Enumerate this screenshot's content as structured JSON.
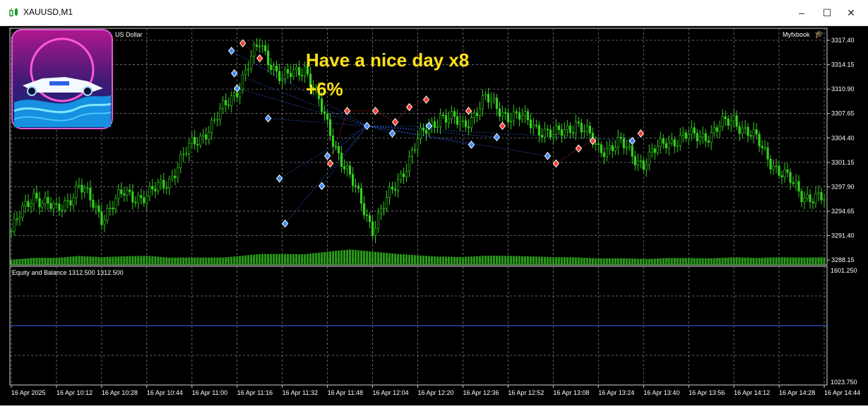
{
  "window": {
    "title": "XAUUSD,M1",
    "minimize": "–",
    "maximize": "☐",
    "close": "✕"
  },
  "main": {
    "symbol_desc": "US Dollar",
    "brand": "Myfxbook",
    "overlay_line1": "Have a nice day x8",
    "overlay_line2": "+6%",
    "price_ticks": [
      "3317.40",
      "3314.15",
      "3310.90",
      "3307.65",
      "3304.40",
      "3301.15",
      "3297.90",
      "3294.65",
      "3291.40",
      "3288.15"
    ]
  },
  "indicator": {
    "label": "Equity and Balance 1312.500 1312.500",
    "ticks": [
      "1601.250",
      "1023.750"
    ]
  },
  "time_axis": [
    "16 Apr 2025",
    "16 Apr 10:12",
    "16 Apr 10:28",
    "16 Apr 10:44",
    "16 Apr 11:00",
    "16 Apr 11:16",
    "16 Apr 11:32",
    "16 Apr 11:48",
    "16 Apr 12:04",
    "16 Apr 12:20",
    "16 Apr 12:36",
    "16 Apr 12:52",
    "16 Apr 13:08",
    "16 Apr 13:24",
    "16 Apr 13:40",
    "16 Apr 13:56",
    "16 Apr 14:12",
    "16 Apr 14:28",
    "16 Apr 14:44"
  ],
  "chart_data": {
    "type": "line",
    "series": [
      {
        "x": [
          0,
          8,
          16,
          24,
          32,
          40,
          48,
          56,
          64,
          72,
          80,
          88,
          96,
          104,
          112,
          120,
          128,
          136,
          144,
          152,
          160,
          168,
          176,
          184,
          192,
          200,
          208,
          216,
          224,
          232,
          240,
          248,
          256,
          264,
          272,
          280,
          288
        ],
        "values": [
          3292.0,
          3297.0,
          3294.5,
          3298.0,
          3294.0,
          3297.0,
          3296.5,
          3299.0,
          3303.5,
          3306.5,
          3311.0,
          3317.0,
          3312.0,
          3314.0,
          3306.0,
          3299.0,
          3292.5,
          3298.0,
          3304.0,
          3307.5,
          3306.0,
          3309.5,
          3307.5,
          3306.5,
          3304.5,
          3306.5,
          3303.0,
          3303.5,
          3301.0,
          3304.0,
          3304.5,
          3305.0,
          3307.0,
          3304.0,
          3300.0,
          3297.0,
          3296.0
        ]
      }
    ],
    "volume_levels": [
      0.45,
      0.55,
      0.5,
      0.6,
      0.5,
      0.55,
      0.6,
      0.5,
      0.55,
      0.6,
      0.7,
      0.8,
      0.75,
      0.7,
      0.85,
      1.0,
      0.9,
      0.8,
      0.75,
      0.7,
      0.6,
      0.65,
      0.6,
      0.55,
      0.5,
      0.5,
      0.45,
      0.5,
      0.5,
      0.55,
      0.5,
      0.45,
      0.5,
      0.45,
      0.5,
      0.5,
      0.55
    ],
    "equity_balance": [
      1312.5,
      1312.5
    ],
    "buy_markers": [
      [
        78,
        3316.0
      ],
      [
        79,
        3313.0
      ],
      [
        80,
        3311.0
      ],
      [
        91,
        3307.0
      ],
      [
        95,
        3299.0
      ],
      [
        97,
        3293.0
      ],
      [
        110,
        3298.0
      ],
      [
        112,
        3302.0
      ],
      [
        126,
        3306.0
      ],
      [
        135,
        3305.0
      ],
      [
        148,
        3306.0
      ],
      [
        163,
        3303.5
      ],
      [
        172,
        3304.5
      ],
      [
        190,
        3302.0
      ],
      [
        220,
        3304.0
      ]
    ],
    "sell_markers": [
      [
        82,
        3317.0
      ],
      [
        88,
        3315.0
      ],
      [
        113,
        3301.0
      ],
      [
        119,
        3308.0
      ],
      [
        129,
        3308.0
      ],
      [
        136,
        3306.5
      ],
      [
        141,
        3308.5
      ],
      [
        147,
        3309.5
      ],
      [
        162,
        3308.0
      ],
      [
        174,
        3306.0
      ],
      [
        193,
        3301.0
      ],
      [
        201,
        3303.0
      ],
      [
        206,
        3304.0
      ],
      [
        223,
        3305.0
      ]
    ],
    "ylim": [
      3287.5,
      3319.0
    ],
    "ylim_indicator": [
      1023.75,
      1601.25
    ],
    "grid": true
  }
}
